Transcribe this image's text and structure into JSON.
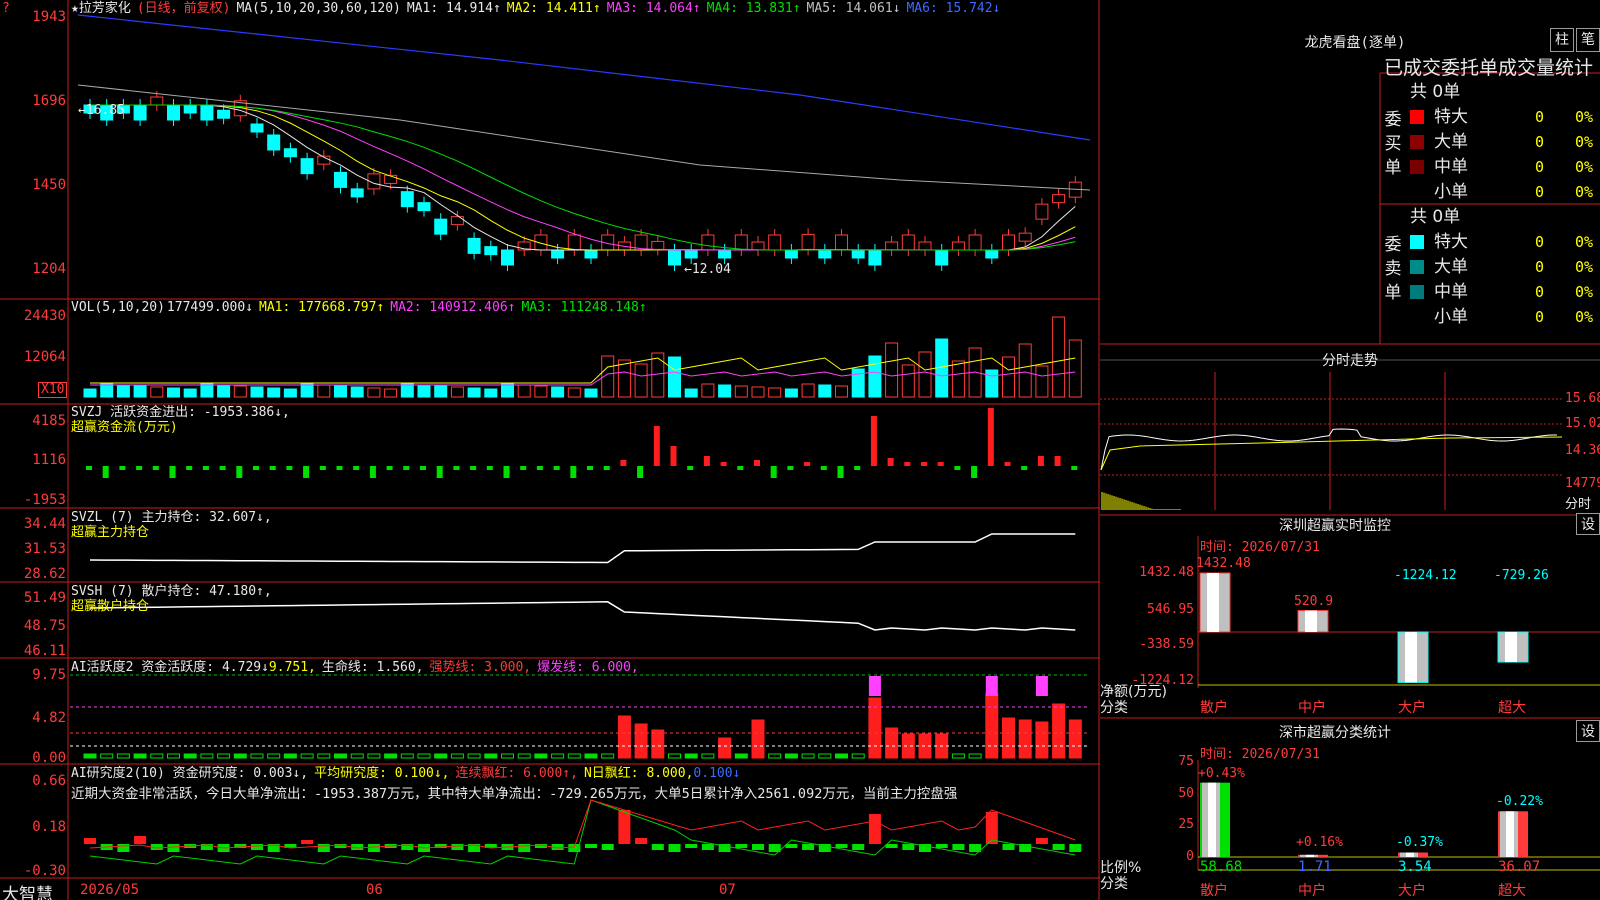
{
  "app": {
    "brand": "大智慧"
  },
  "header": {
    "badge": "?",
    "stock_name": "★拉芳家化",
    "period": "(日线，前复权)",
    "ma_label": "MA(5,10,20,30,60,120)",
    "ma": [
      {
        "t": "MA1: 14.914↑",
        "c": "#e8e8e8"
      },
      {
        "t": "MA2: 14.411↑",
        "c": "#ffff00"
      },
      {
        "t": "MA3: 14.064↑",
        "c": "#ff40ff"
      },
      {
        "t": "MA4: 13.831↑",
        "c": "#00e000"
      },
      {
        "t": "MA5: 14.061↓",
        "c": "#c0c0c0"
      },
      {
        "t": "MA6: 15.742↓",
        "c": "#3a6bff"
      }
    ]
  },
  "price_axis": [
    "1943",
    "1696",
    "1450",
    "1204"
  ],
  "price_annotations": {
    "high": "←16.85",
    "low": "←12.04"
  },
  "vol": {
    "label": "VOL(5,10,20)",
    "value": "177499.000↓",
    "ma1": "MA1: 177668.797↑",
    "ma2": "MA2: 140912.406↑",
    "ma3": "MA3: 111248.148↑",
    "axis": [
      "24430",
      "12064"
    ],
    "unit": "X10"
  },
  "svzj": {
    "label": "SVZJ  活跃资金进出: -1953.386↓,",
    "sub": "超赢资金流(万元)",
    "axis": [
      "4185",
      "1116",
      "-1953"
    ]
  },
  "svzl": {
    "label": "SVZL (7) 主力持仓: 32.607↓,",
    "sub": "超赢主力持仓",
    "axis": [
      "34.44",
      "31.53",
      "28.62"
    ]
  },
  "svsh": {
    "label": "SVSH (7) 散户持仓: 47.180↑,",
    "sub": "超赢散户持仓",
    "axis": [
      "51.49",
      "48.75",
      "46.11"
    ]
  },
  "ai1": {
    "label": "AI活跃度2 资金活跃度: 4.729↓",
    "v2": "9.751,",
    "v3": "生命线: 1.560,",
    "v4": "强势线: 3.000,",
    "v5": "爆发线: 6.000,",
    "axis": [
      "9.75",
      "4.82",
      "0.00"
    ]
  },
  "ai2": {
    "label": "AI研究度2(10) 资金研究度: 0.003↓,",
    "v2": "平均研究度: 0.100↓,",
    "v3": "连续飘红: 6.000↑,",
    "v4": "N日飘红: 8.000,",
    "v5": "0.100↓",
    "text": "近期大资金非常活跃，今日大单净流出：-1953.387万元，其中特大单净流出：-729.265万元，大单5日累计净入2561.092万元，当前主力控盘强",
    "axis": [
      "0.66",
      "0.18",
      "-0.30"
    ]
  },
  "xaxis": [
    "2026/05",
    "06",
    "07"
  ],
  "lhb": {
    "title": "龙虎看盘(逐单)",
    "btn1": "柱",
    "btn2": "笔",
    "tabs": "已成交委托单成交量统计",
    "buy": {
      "side": "委买单",
      "total": "共 0单",
      "rows": [
        {
          "label": "特大",
          "n": "0",
          "p": "0%",
          "c": "#ff0000"
        },
        {
          "label": "大单",
          "n": "0",
          "p": "0%",
          "c": "#8b0000"
        },
        {
          "label": "中单",
          "n": "0",
          "p": "0%",
          "c": "#7a0000"
        },
        {
          "label": "小单",
          "n": "0",
          "p": "0%",
          "c": ""
        }
      ]
    },
    "sell": {
      "side": "委卖单",
      "total": "共 0单",
      "rows": [
        {
          "label": "特大",
          "n": "0",
          "p": "0%",
          "c": "#00ffff"
        },
        {
          "label": "大单",
          "n": "0",
          "p": "0%",
          "c": "#008b8b"
        },
        {
          "label": "中单",
          "n": "0",
          "p": "0%",
          "c": "#007a7a"
        },
        {
          "label": "小单",
          "n": "0",
          "p": "0%",
          "c": ""
        }
      ]
    }
  },
  "intraday": {
    "title": "分时走势",
    "axis": [
      "15.68",
      "15.02",
      "14.36",
      "14779",
      "分时"
    ]
  },
  "sz_monitor": {
    "title": "深圳超赢实时监控",
    "btn": "设",
    "time": "时间: 2026/07/31",
    "axis": [
      "1432.48",
      "546.95",
      "-338.59",
      "-1224.12"
    ],
    "ylabel": "净额(万元)",
    "cat_label": "分类",
    "chart_data": {
      "type": "bar",
      "categories": [
        "散户",
        "中户",
        "大户",
        "超大"
      ],
      "values": [
        1432.48,
        520.9,
        -1224.12,
        -729.26
      ],
      "labels": [
        "1432.48",
        "520.9",
        "-1224.12",
        "-729.26"
      ]
    }
  },
  "sz_class": {
    "title": "深市超赢分类统计",
    "btn": "设",
    "time": "时间: 2026/07/31",
    "axis": [
      "75",
      "50",
      "25",
      "0"
    ],
    "ylabel": "比例%",
    "cat_label": "分类",
    "chart_data": {
      "type": "bar",
      "categories": [
        "散户",
        "中户",
        "大户",
        "超大"
      ],
      "values": [
        58.68,
        1.71,
        3.54,
        36.07
      ],
      "changes": [
        "+0.43%",
        "+0.16%",
        "-0.37%",
        "-0.22%"
      ]
    }
  }
}
